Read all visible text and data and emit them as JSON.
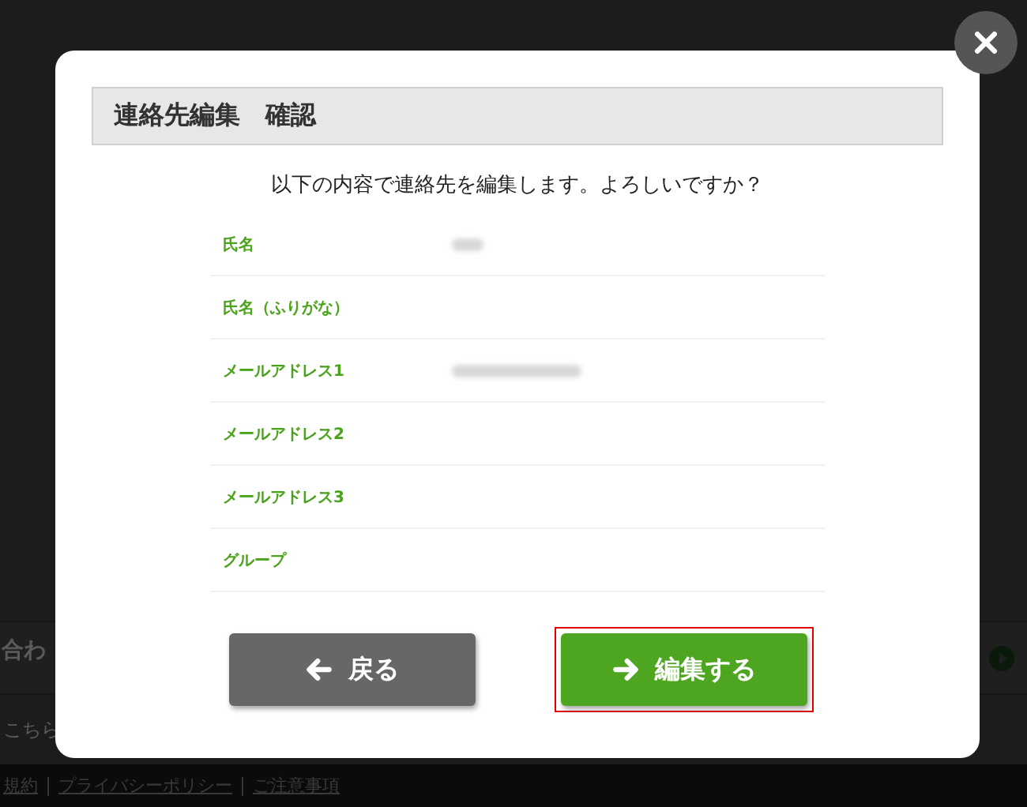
{
  "background_page": {
    "section_heading": "合わ",
    "link_text": "こちら",
    "footer_links": [
      "規約",
      "プライバシーポリシー",
      "ご注意事項"
    ]
  },
  "dialog": {
    "title": "連絡先編集　確認",
    "message": "以下の内容で連絡先を編集します。よろしいですか？",
    "fields": [
      {
        "label": "氏名",
        "blurred": true
      },
      {
        "label": "氏名（ふりがな）"
      },
      {
        "label": "メールアドレス1",
        "blurred": true
      },
      {
        "label": "メールアドレス2"
      },
      {
        "label": "メールアドレス3"
      },
      {
        "label": "グループ"
      }
    ],
    "buttons": [
      {
        "kind": "back",
        "label": "戻る",
        "focused": false
      },
      {
        "kind": "submit",
        "label": "編集する",
        "focused": true
      }
    ]
  }
}
